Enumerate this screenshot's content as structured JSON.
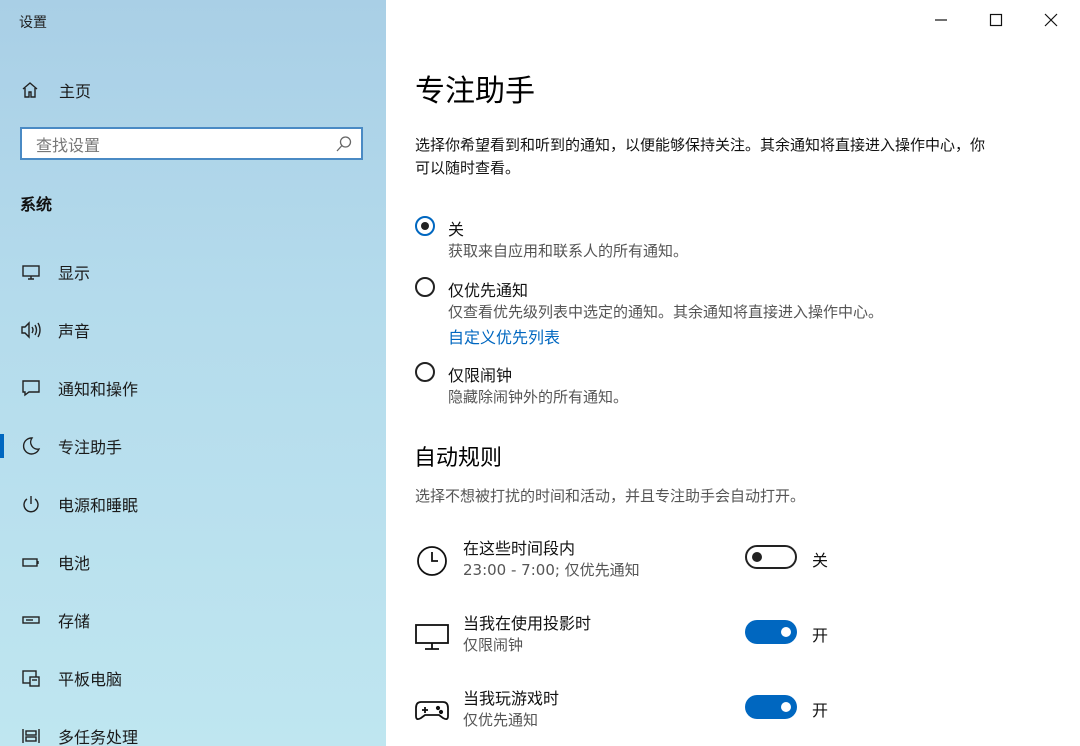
{
  "window": {
    "title": "设置"
  },
  "sidebar": {
    "home_label": "主页",
    "search": {
      "placeholder": "查找设置",
      "value": ""
    },
    "section_title": "系统",
    "items": [
      {
        "icon": "display-icon",
        "label": "显示"
      },
      {
        "icon": "sound-icon",
        "label": "声音"
      },
      {
        "icon": "notification-icon",
        "label": "通知和操作"
      },
      {
        "icon": "moon-icon",
        "label": "专注助手",
        "selected": true
      },
      {
        "icon": "power-icon",
        "label": "电源和睡眠"
      },
      {
        "icon": "battery-icon",
        "label": "电池"
      },
      {
        "icon": "storage-icon",
        "label": "存储"
      },
      {
        "icon": "tablet-icon",
        "label": "平板电脑"
      },
      {
        "icon": "multitask-icon",
        "label": "多任务处理"
      }
    ]
  },
  "main": {
    "title": "专注助手",
    "description": "选择你希望看到和听到的通知，以便能够保持关注。其余通知将直接进入操作中心，你可以随时查看。",
    "options": [
      {
        "label": "关",
        "sub": "获取来自应用和联系人的所有通知。",
        "selected": true
      },
      {
        "label": "仅优先通知",
        "sub": "仅查看优先级列表中选定的通知。其余通知将直接进入操作中心。",
        "link": "自定义优先列表",
        "selected": false
      },
      {
        "label": "仅限闹钟",
        "sub": "隐藏除闹钟外的所有通知。",
        "selected": false
      }
    ],
    "auto_rules": {
      "title": "自动规则",
      "description": "选择不想被打扰的时间和活动，并且专注助手会自动打开。",
      "rules": [
        {
          "icon": "clock-icon",
          "name": "在这些时间段内",
          "detail": "23:00 - 7:00; 仅优先通知",
          "on": false,
          "state": "关"
        },
        {
          "icon": "monitor-icon",
          "name": "当我在使用投影时",
          "detail": "仅限闹钟",
          "on": true,
          "state": "开"
        },
        {
          "icon": "gamepad-icon",
          "name": "当我玩游戏时",
          "detail": "仅优先通知",
          "on": true,
          "state": "开"
        }
      ]
    }
  },
  "colors": {
    "accent": "#0067c0",
    "sidebar_top": "#a9cfe6",
    "sidebar_bottom": "#bfe6f0"
  }
}
